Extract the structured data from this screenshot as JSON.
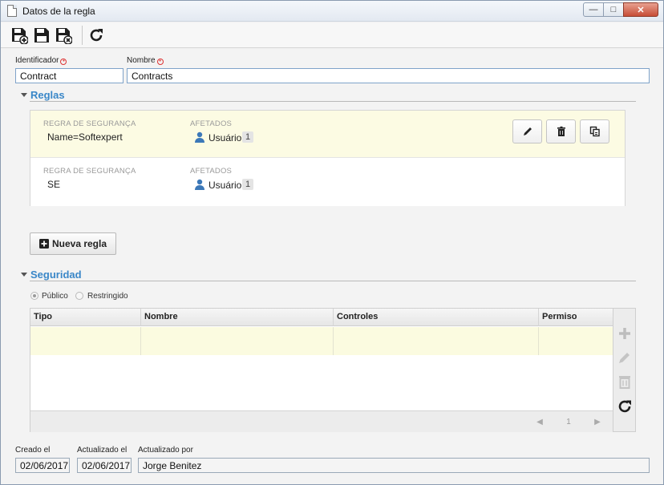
{
  "window": {
    "title": "Datos de la regla"
  },
  "toolbar": {
    "buttons": [
      {
        "name": "save-new",
        "icon": "save-plus-icon"
      },
      {
        "name": "save",
        "icon": "save-icon"
      },
      {
        "name": "save-close",
        "icon": "save-close-icon"
      },
      {
        "name": "refresh",
        "icon": "refresh-icon"
      }
    ]
  },
  "form": {
    "identificador_label": "Identificador",
    "identificador_value": "Contract",
    "nombre_label": "Nombre",
    "nombre_value": "Contracts"
  },
  "reglas": {
    "title": "Reglas",
    "rows": [
      {
        "rule_caption": "REGRA DE SEGURANÇA",
        "rule_value": "Name=Softexpert",
        "affected_caption": "AFETADOS",
        "affected_label": "Usuário",
        "affected_count": "1"
      },
      {
        "rule_caption": "REGRA DE SEGURANÇA",
        "rule_value": "SE",
        "affected_caption": "AFETADOS",
        "affected_label": "Usuário",
        "affected_count": "1"
      }
    ],
    "new_rule_label": "Nueva regla"
  },
  "seguridad": {
    "title": "Seguridad",
    "radio_public": "Público",
    "radio_restricted": "Restringido",
    "selected": "Público",
    "columns": [
      "Tipo",
      "Nombre",
      "Controles",
      "Permiso"
    ],
    "pager_page": "1"
  },
  "footer": {
    "creado_label": "Creado el",
    "creado_value": "02/06/2017",
    "actualizado_label": "Actualizado el",
    "actualizado_value": "02/06/2017",
    "actualizado_por_label": "Actualizado por",
    "actualizado_por_value": "Jorge Benitez"
  },
  "colors": {
    "accent": "#3a87c8",
    "highlight_row": "#fcfbe3",
    "close_button": "#c74d37"
  }
}
